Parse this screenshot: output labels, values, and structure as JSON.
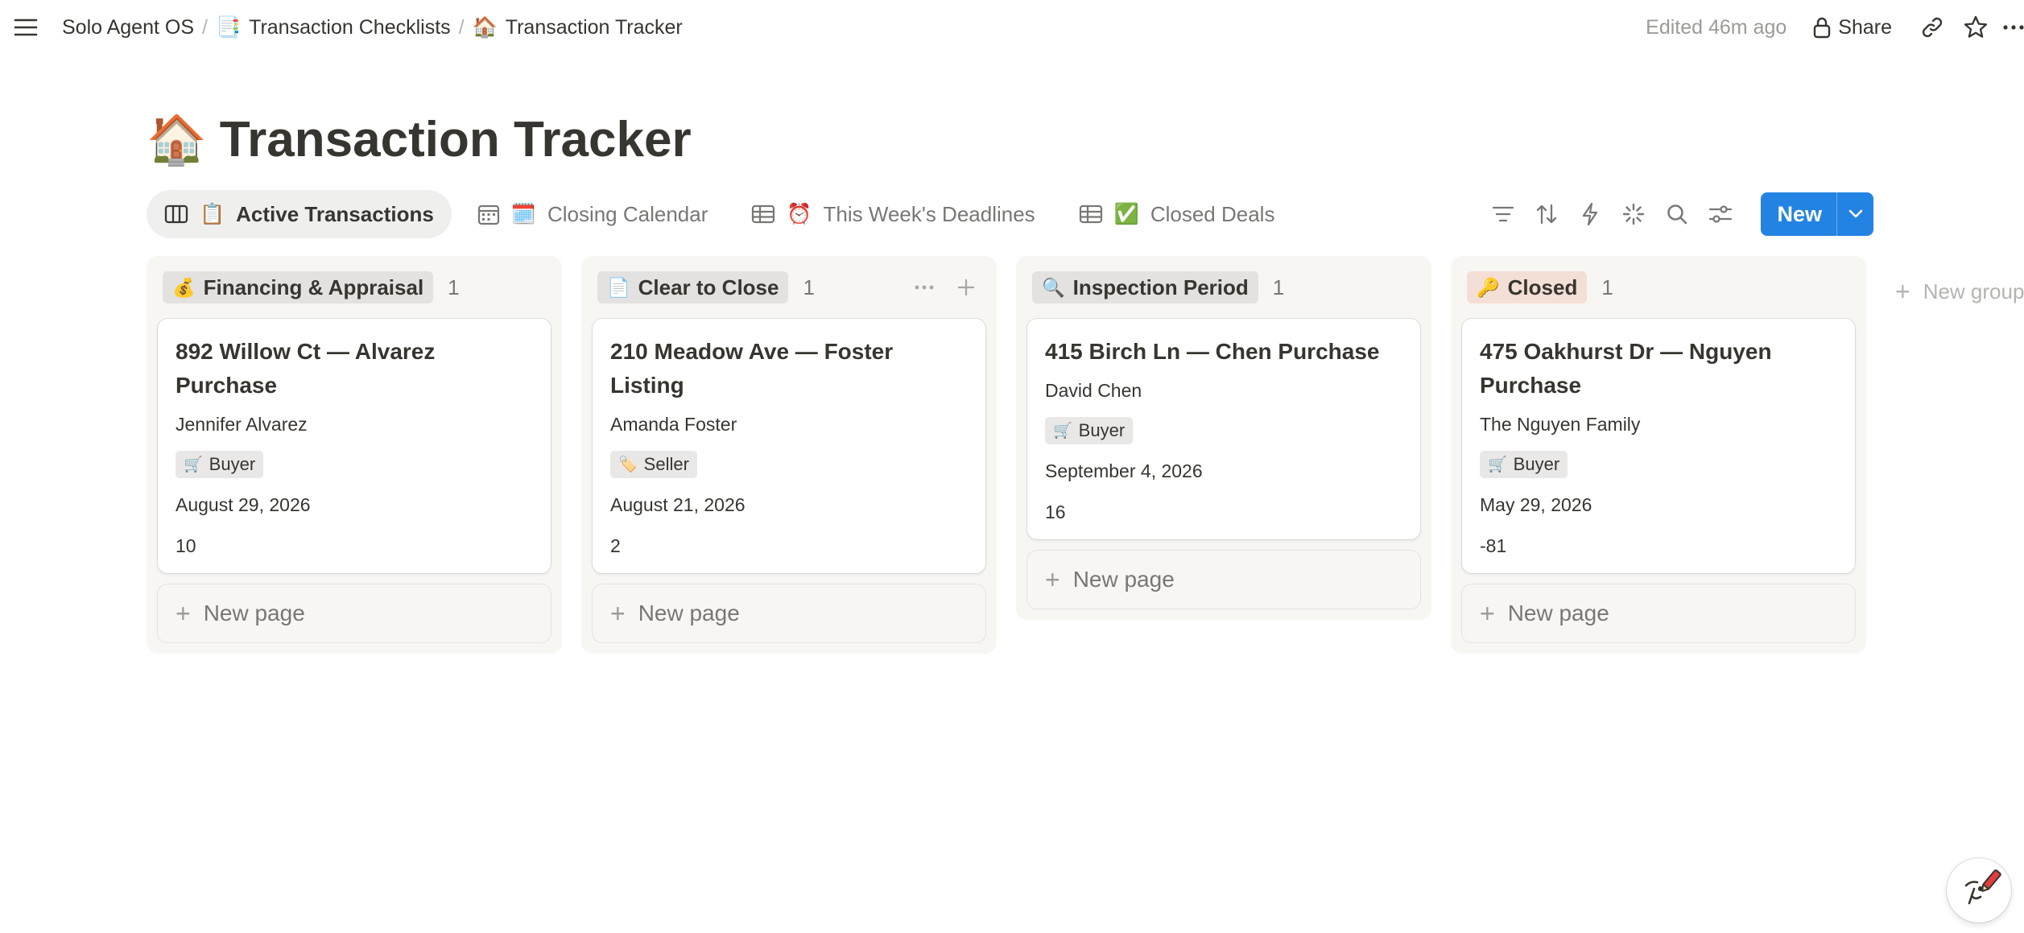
{
  "breadcrumb": {
    "root": "Solo Agent OS",
    "parent_emoji": "📑",
    "parent": "Transaction Checklists",
    "current_emoji": "🏠",
    "current": "Transaction Tracker"
  },
  "topbar": {
    "edited": "Edited 46m ago",
    "share_label": "Share"
  },
  "page": {
    "emoji": "🏠",
    "title": "Transaction Tracker"
  },
  "views": [
    {
      "emoji": "📋",
      "label": "Active Transactions",
      "icon": "board-icon",
      "active": true
    },
    {
      "emoji": "🗓️",
      "label": "Closing Calendar",
      "icon": "calendar-icon",
      "active": false
    },
    {
      "emoji": "⏰",
      "label": "This Week's Deadlines",
      "icon": "table-icon",
      "active": false
    },
    {
      "emoji": "✅",
      "label": "Closed Deals",
      "icon": "table-icon",
      "active": false
    }
  ],
  "toolbar": {
    "new_label": "New",
    "icons": [
      "filter-icon",
      "sort-icon",
      "automation-icon",
      "ai-sparkle-icon",
      "search-icon",
      "settings-icon"
    ]
  },
  "board": {
    "new_page_label": "New page",
    "new_group_label": "New group",
    "columns": [
      {
        "emoji": "💰",
        "name": "Financing & Appraisal",
        "count": "1",
        "cards": [
          {
            "title": "892 Willow Ct — Alvarez Purchase",
            "client": "Jennifer Alvarez",
            "role_emoji": "🛒",
            "role": "Buyer",
            "date": "August 29, 2026",
            "days": "10"
          }
        ]
      },
      {
        "emoji": "📄",
        "name": "Clear to Close",
        "count": "1",
        "cards": [
          {
            "title": "210 Meadow Ave — Foster Listing",
            "client": "Amanda Foster",
            "role_emoji": "🏷️",
            "role": "Seller",
            "date": "August 21, 2026",
            "days": "2"
          }
        ]
      },
      {
        "emoji": "🔍",
        "name": "Inspection Period",
        "count": "1",
        "cards": [
          {
            "title": "415 Birch Ln — Chen Purchase",
            "client": "David Chen",
            "role_emoji": "🛒",
            "role": "Buyer",
            "date": "September 4, 2026",
            "days": "16"
          }
        ]
      },
      {
        "emoji": "🔑",
        "name": "Closed",
        "count": "1",
        "cards": [
          {
            "title": "475 Oakhurst Dr — Nguyen Purchase",
            "client": "The Nguyen Family",
            "role_emoji": "🛒",
            "role": "Buyer",
            "date": "May 29, 2026",
            "days": "-81"
          }
        ]
      }
    ]
  }
}
